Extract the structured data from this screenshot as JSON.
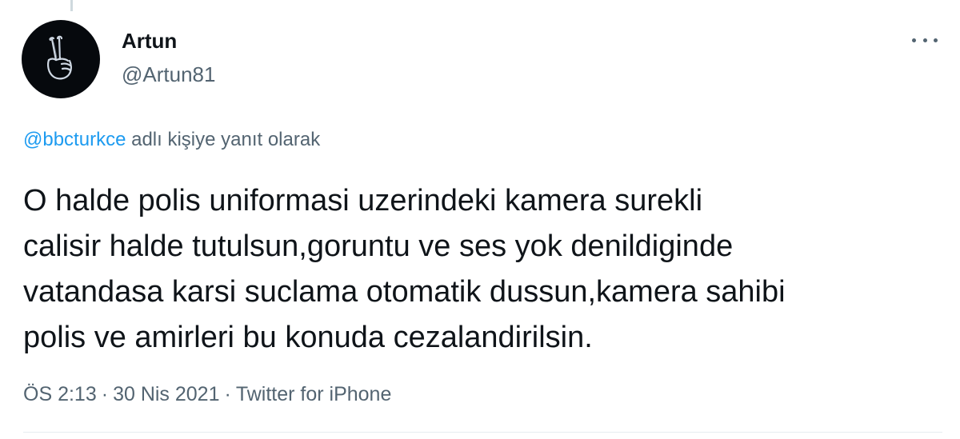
{
  "tweet": {
    "author": {
      "display_name": "Artun",
      "handle": "@Artun81",
      "avatar_icon": "peace-hand-icon"
    },
    "more_icon": "more-horizontal-icon",
    "reply_to": {
      "mention": "@bbcturkce",
      "suffix": " adlı kişiye yanıt olarak"
    },
    "text": "O halde polis uniformasi uzerindeki kamera surekli\ncalisir halde tutulsun,goruntu ve ses yok denildiginde\nvatandasa karsi suclama otomatik dussun,kamera sahibi\npolis ve amirleri bu konuda cezalandirilsin.",
    "meta": {
      "time": "ÖS 2:13",
      "separator": "·",
      "date": "30 Nis 2021",
      "source": "Twitter for iPhone"
    }
  },
  "colors": {
    "text_primary": "#0f1419",
    "text_secondary": "#536471",
    "link": "#1d9bf0",
    "divider": "#e6ecf0"
  }
}
